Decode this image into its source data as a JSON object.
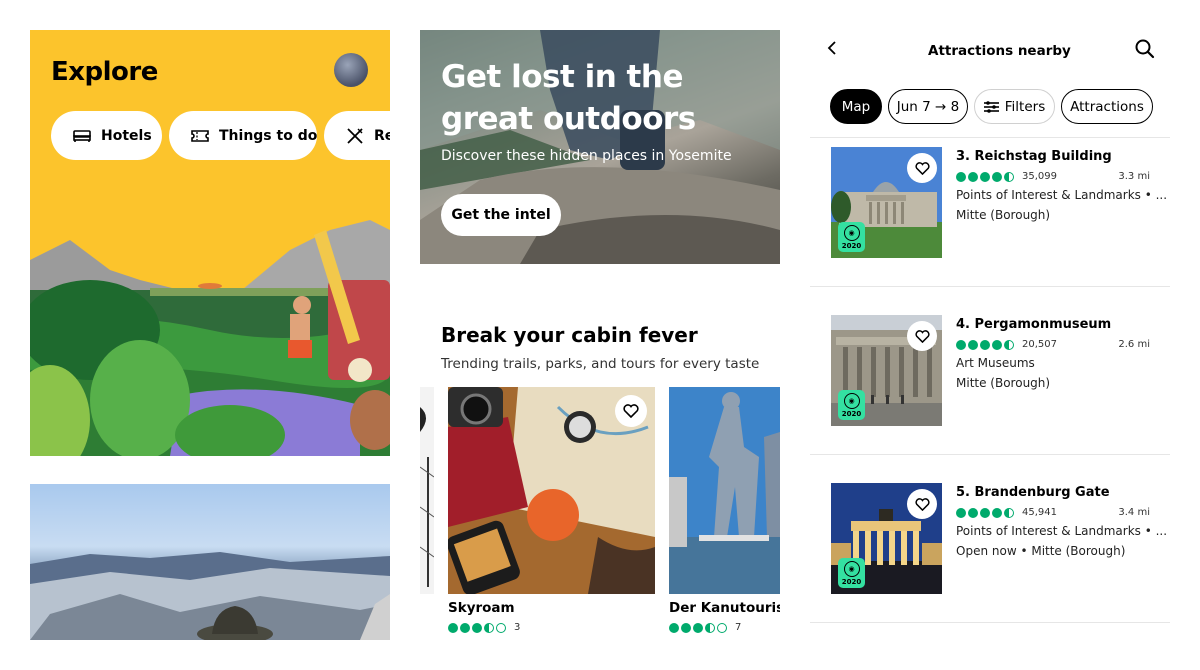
{
  "explore": {
    "title": "Explore",
    "pills": [
      {
        "label": "Hotels",
        "icon": "bed-icon"
      },
      {
        "label": "Things to do",
        "icon": "ticket-icon"
      },
      {
        "label": "Re",
        "icon": "utensils-icon"
      }
    ]
  },
  "hero": {
    "headline": "Get lost in the great outdoors",
    "subtitle": "Discover these hidden places in Yosemite",
    "cta": "Get the intel"
  },
  "section": {
    "title": "Break your cabin fever",
    "subtitle": "Trending trails, parks, and tours for every taste",
    "cards": [
      {
        "name": "Skyroam",
        "rating": 3.5,
        "count": "3"
      },
      {
        "name": "Der Kanutourist D",
        "rating": 3.5,
        "count": "7"
      }
    ]
  },
  "attractions": {
    "title": "Attractions nearby",
    "filters": [
      {
        "label": "Map",
        "active": true
      },
      {
        "label": "Jun 7 → 8",
        "active": false
      },
      {
        "label": "Filters",
        "active": false
      },
      {
        "label": "Attractions",
        "active": false
      }
    ],
    "award_year": "2020",
    "items": [
      {
        "name": "3. Reichstag Building",
        "rating": 4.5,
        "reviews": "35,099",
        "distance": "3.3 mi",
        "category": "Points of Interest & Landmarks • ...",
        "location": "Mitte (Borough)"
      },
      {
        "name": "4. Pergamonmuseum",
        "rating": 4.5,
        "reviews": "20,507",
        "distance": "2.6 mi",
        "category": "Art Museums",
        "location": "Mitte (Borough)"
      },
      {
        "name": "5. Brandenburg Gate",
        "rating": 4.5,
        "reviews": "45,941",
        "distance": "3.4 mi",
        "category": "Points of Interest & Landmarks • ...",
        "location": "Open now • Mitte (Borough)"
      }
    ]
  },
  "colors": {
    "brand_yellow": "#fcc42c",
    "rating_green": "#00aa6c",
    "award_green": "#34e0a1"
  }
}
